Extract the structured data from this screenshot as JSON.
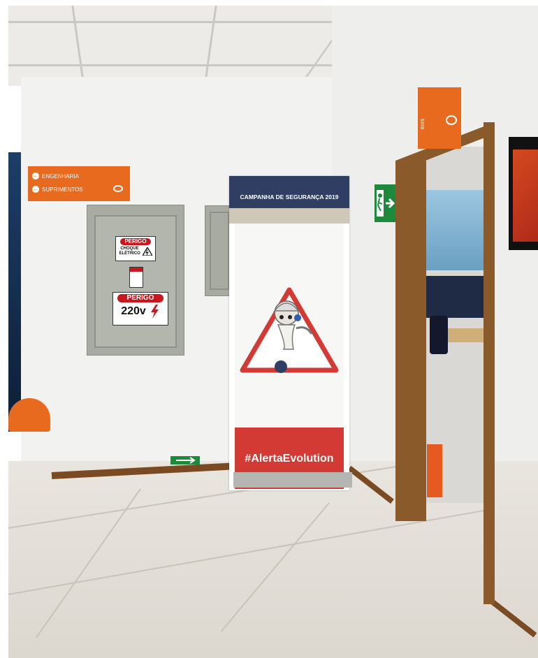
{
  "direction_sign": {
    "line1": "ENGENHARIA",
    "line2": "SUPRIMENTOS"
  },
  "electrical_panel": {
    "warning_top_header": "PERIGO",
    "warning_top_text": "CHOQUE ELÉTRICO",
    "warning_bottom_header": "PERIGO",
    "warning_bottom_text": "220v"
  },
  "banner": {
    "title": "CAMPANHA DE SEGURANÇA 2019",
    "hashtag": "#AlertaEvolution"
  },
  "door_sign": {
    "label": "BMS"
  },
  "colors": {
    "orange_sign": "#e86a1e",
    "banner_navy": "#2f3e62",
    "banner_red": "#d23a33",
    "warning_red": "#c8171d",
    "exit_green": "#1c8a3a"
  },
  "icons": [
    "arrow-left-icon",
    "electric-shock-icon",
    "lightning-bolt-icon",
    "exit-running-man-icon",
    "exit-arrow-icon"
  ]
}
